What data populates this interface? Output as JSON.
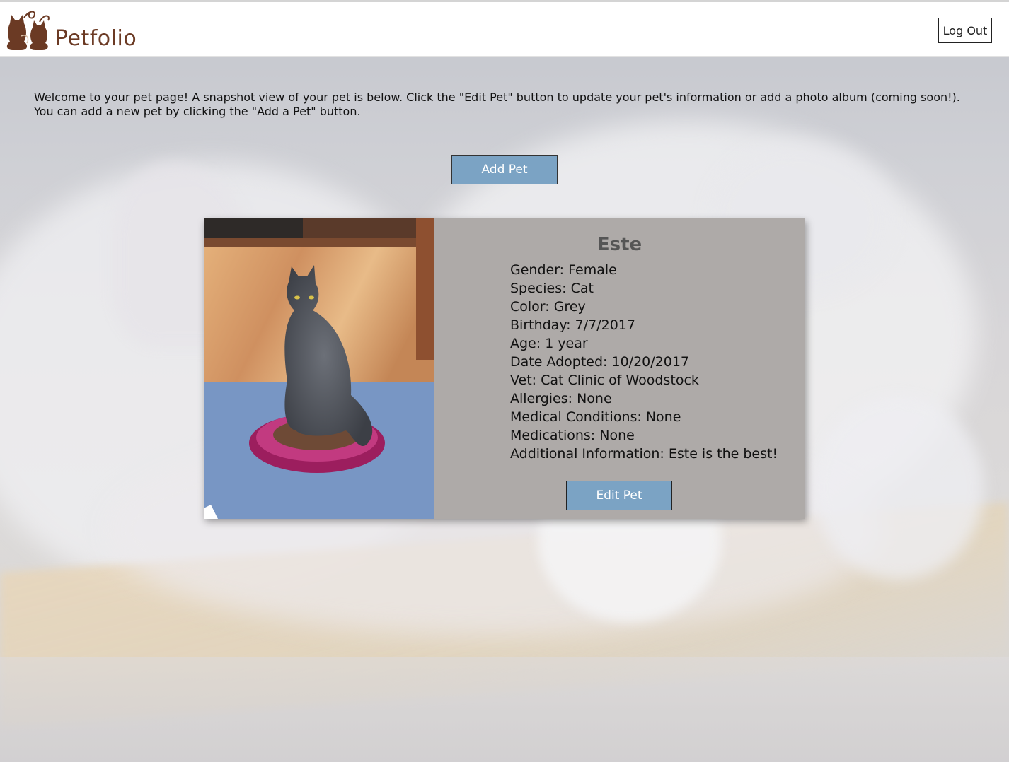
{
  "header": {
    "brand": "Petfolio",
    "logout_label": "Log Out"
  },
  "intro": {
    "line1": "Welcome to your pet page! A snapshot view of your pet is below. Click the \"Edit Pet\" button to update your pet's information or add a photo album (coming soon!).",
    "line2": "You can add a new pet by clicking the \"Add a Pet\" button."
  },
  "add_pet_label": "Add Pet",
  "pet": {
    "name": "Este",
    "details": [
      "Gender: Female",
      "Species: Cat",
      "Color: Grey",
      "Birthday: 7/7/2017",
      "Age: 1 year",
      "Date Adopted: 10/20/2017",
      "Vet: Cat Clinic of Woodstock",
      "Allergies: None",
      "Medical Conditions: None",
      "Medications: None",
      "Additional Information: Este is the best!"
    ],
    "edit_label": "Edit Pet"
  },
  "colors": {
    "brand": "#6b3a24",
    "button": "#7ba3c4",
    "card": "#aeaaa8"
  }
}
